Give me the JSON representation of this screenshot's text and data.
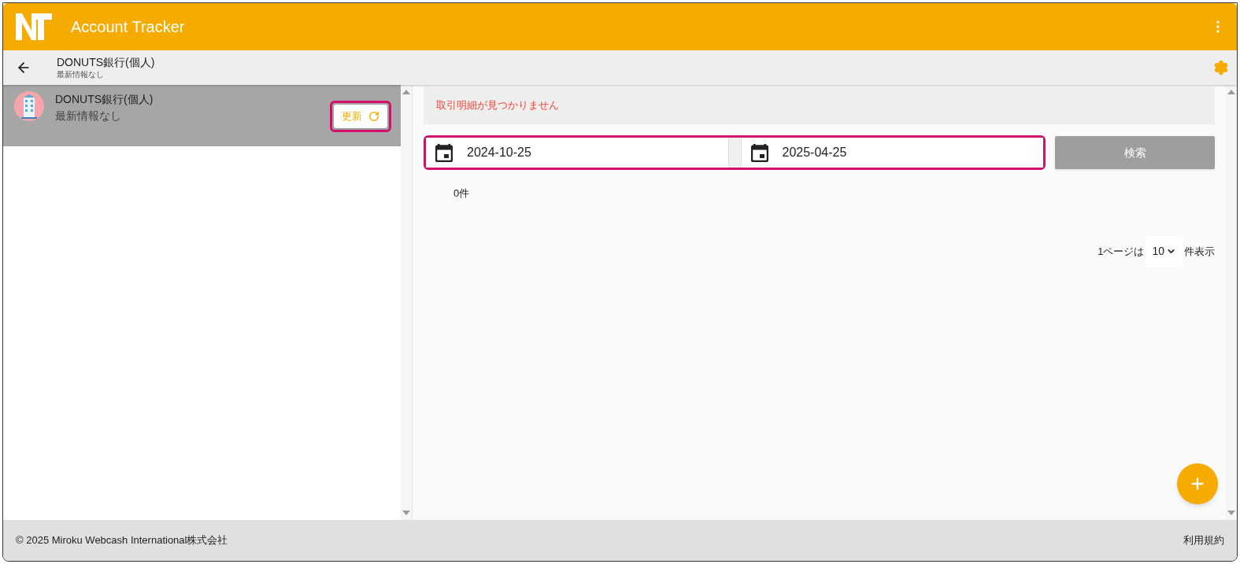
{
  "app_bar": {
    "title": "Account Tracker"
  },
  "sub_header": {
    "title": "DONUTS銀行(個人)",
    "subtitle": "最新情報なし"
  },
  "accounts": [
    {
      "name": "DONUTS銀行(個人)",
      "status": "最新情報なし",
      "selected": true,
      "refresh_label": "更新"
    }
  ],
  "error_message": "取引明細が見つかりません",
  "date_range": {
    "from": "2024-10-25",
    "to": "2025-04-25"
  },
  "search_button": "検索",
  "result_count": "0件",
  "pagination": {
    "prefix": "1ページは",
    "page_size": "10",
    "suffix": "件表示"
  },
  "footer": {
    "copyright": "© 2025 Miroku Webcash International株式会社",
    "terms_link": "利用規約"
  }
}
